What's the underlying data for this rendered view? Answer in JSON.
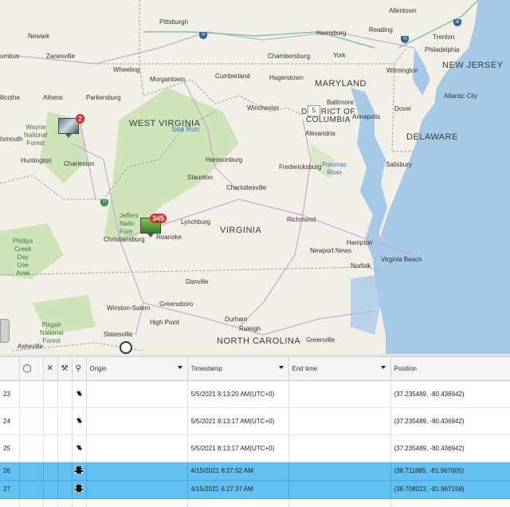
{
  "map": {
    "states": [
      "WEST VIRGINIA",
      "MARYLAND",
      "DISTRICT OF COLUMBIA",
      "NEW JERSEY",
      "DELAWARE",
      "VIRGINIA",
      "NORTH CAROLINA"
    ],
    "cities": {
      "pittsburgh": "Pittsburgh",
      "allentown": "Allentown",
      "newark": "Newark",
      "columbus": "umbus",
      "zanesville": "Zanesville",
      "wheeling": "Wheeling",
      "harrisburg": "Harrisburg",
      "reading": "Reading",
      "trenton": "Trenton",
      "philadelphia": "Philadelphia",
      "chambersburg": "Chambersburg",
      "york": "York",
      "wilmington": "Wilmington",
      "morgantown": "Morgantown",
      "cumberland": "Cumberland",
      "hagerstown": "Hagerstown",
      "athens": "Athens",
      "parkersburg": "Parkersburg",
      "baltimore": "Baltimore",
      "chillicothe": "llicothe",
      "winchester": "Winchester",
      "annapolis": "Annapolis",
      "dover": "Dover",
      "atlantic_city": "Atlantic City",
      "portsmouth": "tsmouth",
      "alexandria": "Alexandria",
      "huntington": "Huntington",
      "charleston": "Charleston",
      "harrisonburg": "Harrisonburg",
      "fredericksburg": "Fredericksburg",
      "salisbury": "Salisbury",
      "staunton": "Staunton",
      "charlottesville": "Charlottesville",
      "lynchburg": "Lynchburg",
      "roanoke": "Roanoke",
      "christiansburg": "Christiansburg",
      "richmond": "Richmond",
      "hampton": "Hampton",
      "newport_news": "Newport News",
      "norfolk": "Norfolk",
      "virginia_beach": "Virginia Beach",
      "danville": "Danville",
      "winston_salem": "Winston-Salem",
      "greensboro": "Greensboro",
      "high_point": "High Point",
      "raleigh": "Raleigh",
      "durham": "Durham",
      "greenville": "Greenville",
      "statesville": "Statesville",
      "asheville": "Asheville"
    },
    "water": {
      "sea_run": "Sea Run",
      "potomac": "Potomac\nRiver"
    },
    "parks": {
      "wayne": "Wayne\nNational\nForest",
      "jefferson": "Jeffers\nNatio\nFore",
      "phillips": "Phillips\nCreek\nDay\nUse\nArea",
      "pisgah": "Pisgah\nNational\nForest"
    },
    "shields": {
      "i70": "70",
      "i76": "76",
      "i95": "95",
      "i77": "77"
    },
    "dc_count": "5",
    "clusters": [
      {
        "name": "cluster-west",
        "count": "2"
      },
      {
        "name": "cluster-roanoke",
        "count": "345"
      }
    ],
    "colors": {
      "water": "#a7c9e8",
      "land": "#f2efe6",
      "forest": "#cfe3b8",
      "road": "#c9a7d6",
      "highway": "#7bc7a0",
      "border": "#a0a0a0"
    }
  },
  "grid": {
    "headers": {
      "origin": "Origin",
      "timestamp": "Timestamp",
      "end_time": "End time",
      "position": "Position"
    },
    "header_icons": [
      "tag-icon",
      "close-icon",
      "pickaxe-icon",
      "location-pin-icon"
    ],
    "rows": [
      {
        "id": "23",
        "icon": "satellite-icon",
        "timestamp": "5/5/2021 8:13:20 AM(UTC+0)",
        "end_time": "",
        "position": "(37.235489, -80.436942)",
        "selected": false
      },
      {
        "id": "24",
        "icon": "satellite-icon",
        "timestamp": "5/5/2021 8:13:17 AM(UTC+0)",
        "end_time": "",
        "position": "(37.235489, -80.436942)",
        "selected": false
      },
      {
        "id": "25",
        "icon": "satellite-icon",
        "timestamp": "5/5/2021 8:13:17 AM(UTC+0)",
        "end_time": "",
        "position": "(37.235489, -80.436942)",
        "selected": false
      },
      {
        "id": "26",
        "icon": "film-icon",
        "timestamp": "4/15/2021 6:27:52 AM",
        "end_time": "",
        "position": "(38.711885, -81.967605)",
        "selected": true
      },
      {
        "id": "27",
        "icon": "film-icon",
        "timestamp": "4/15/2021 6:27:37 AM",
        "end_time": "",
        "position": "(38.708022, -81.967158)",
        "selected": true
      }
    ]
  }
}
